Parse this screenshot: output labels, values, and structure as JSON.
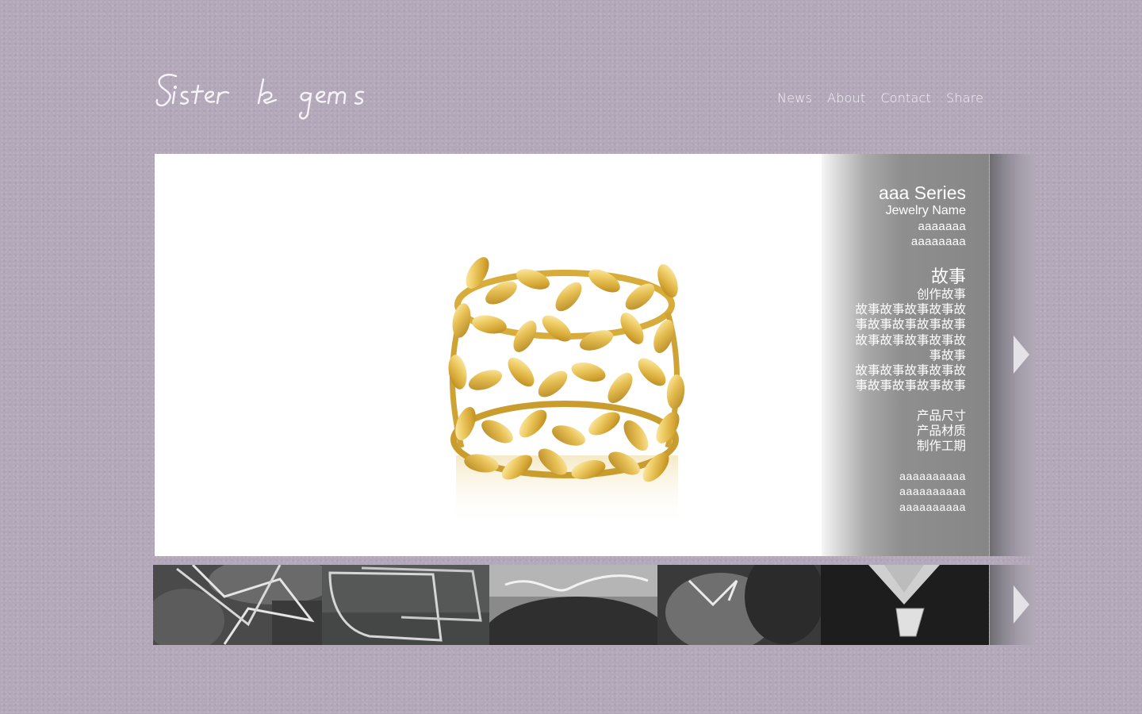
{
  "brand": {
    "logo_text": "Sister & gems"
  },
  "nav": {
    "items": [
      "News",
      "About",
      "Contact",
      "Share"
    ]
  },
  "product": {
    "series": "aaa Series",
    "name_label": "Jewelry Name",
    "name_line1": "aaaaaaa",
    "name_line2": "aaaaaaaa",
    "story_heading": "故事",
    "story_subheading": "创作故事",
    "story_lines": [
      "故事故事故事故事故",
      "事故事故事故事故事",
      "故事故事故事故事故",
      "事故事",
      "故事故事故事故事故",
      "事故事故事故事故事"
    ],
    "spec_labels": [
      "产品尺寸",
      "产品材质",
      "制作工期"
    ],
    "spec_values": [
      "aaaaaaaaaa",
      "aaaaaaaaaa",
      "aaaaaaaaaa"
    ]
  },
  "thumbnails": [
    "necklace-thumbnail-1",
    "bracelet-thumbnail-2",
    "collar-thumbnail-3",
    "ring-thumbnail-4",
    "pendant-thumbnail-5"
  ],
  "colors": {
    "background": "#b3a8ba",
    "panel_gray": "#868686",
    "gold": "#d9b44a"
  }
}
